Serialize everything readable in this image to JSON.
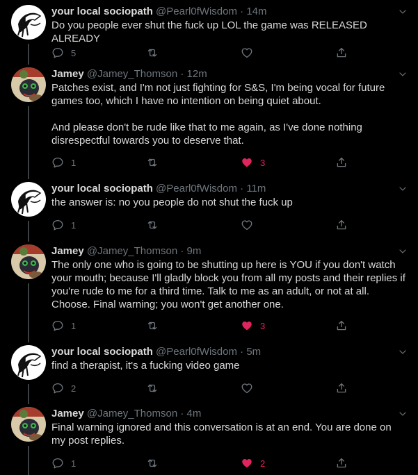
{
  "colors": {
    "background": "#000000",
    "text": "#d9d9d9",
    "muted": "#6e767d",
    "like": "#e0245e",
    "thread_line": "#3d4043"
  },
  "tweets": [
    {
      "avatar": "masked-figure-avatar",
      "name": "your local sociopath",
      "handle": "@Pearl0fWisdom",
      "sep": "·",
      "time": "14m",
      "paragraphs": [
        "Do you people ever shut the fuck up LOL the game was RELEASED ALREADY"
      ],
      "reply_count": "5",
      "retweet_count": "",
      "like_count": "",
      "liked": false
    },
    {
      "avatar": "cartoon-character-avatar",
      "name": "Jamey",
      "handle": "@Jamey_Thomson",
      "sep": "·",
      "time": "12m",
      "paragraphs": [
        "Patches exist, and I'm not just fighting for S&S, I'm being vocal for future games too, which I have no intention on being quiet about.",
        "And please don't be rude like that to me again, as I've done nothing disrespectful towards you to deserve that."
      ],
      "reply_count": "1",
      "retweet_count": "",
      "like_count": "3",
      "liked": true
    },
    {
      "avatar": "masked-figure-avatar",
      "name": "your local sociopath",
      "handle": "@Pearl0fWisdom",
      "sep": "·",
      "time": "11m",
      "paragraphs": [
        "the answer is: no you people do not shut the fuck up"
      ],
      "reply_count": "1",
      "retweet_count": "",
      "like_count": "",
      "liked": false
    },
    {
      "avatar": "cartoon-character-avatar",
      "name": "Jamey",
      "handle": "@Jamey_Thomson",
      "sep": "·",
      "time": "9m",
      "paragraphs": [
        "The only one who is going to be shutting up here is YOU if you don't watch your mouth; because I'll gladly block you from all my posts and their replies if you're rude to me for a third time. Talk to me as an adult, or not at all. Choose. Final warning; you won't get another one."
      ],
      "reply_count": "1",
      "retweet_count": "",
      "like_count": "3",
      "liked": true
    },
    {
      "avatar": "masked-figure-avatar",
      "name": "your local sociopath",
      "handle": "@Pearl0fWisdom",
      "sep": "·",
      "time": "5m",
      "paragraphs": [
        "find a therapist, it's a fucking video game"
      ],
      "reply_count": "2",
      "retweet_count": "",
      "like_count": "",
      "liked": false
    },
    {
      "avatar": "cartoon-character-avatar",
      "name": "Jamey",
      "handle": "@Jamey_Thomson",
      "sep": "·",
      "time": "4m",
      "paragraphs": [
        "Final warning ignored and this conversation is at an end. You are done on my post replies."
      ],
      "reply_count": "1",
      "retweet_count": "",
      "like_count": "2",
      "liked": true
    }
  ]
}
